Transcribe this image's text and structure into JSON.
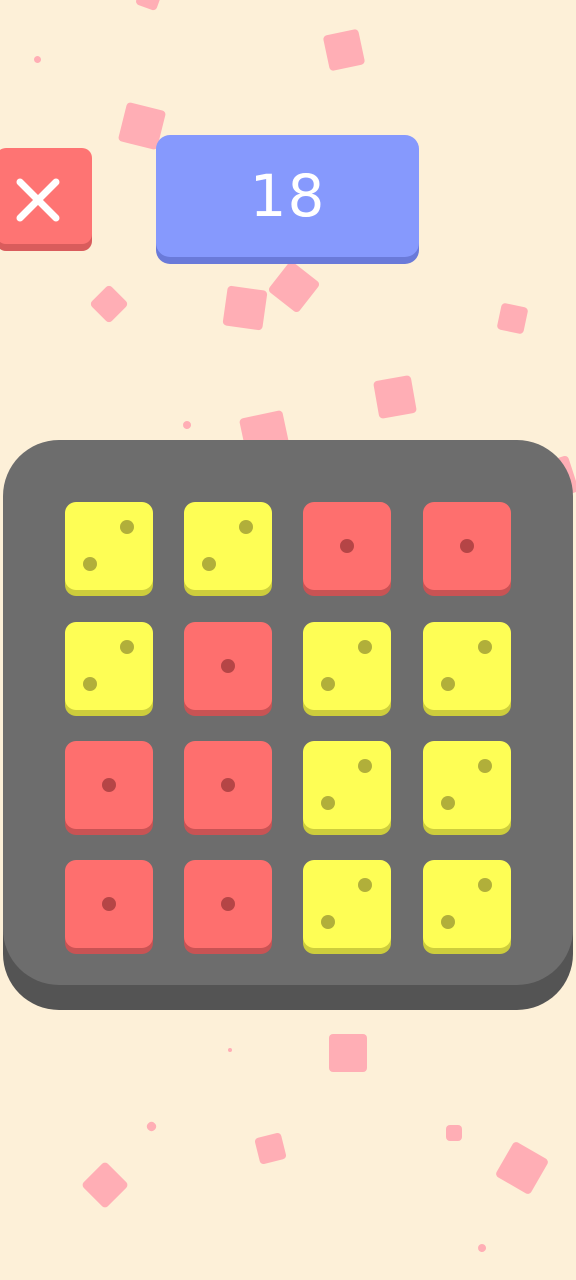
{
  "score": {
    "value": "18"
  },
  "close_button": {
    "icon": "close-icon"
  },
  "colors": {
    "background": "#fdf0d8",
    "confetti": "#ffaeb5",
    "close_button": "#fe7473",
    "score_box": "#8699fd",
    "board": "#6d6d6d",
    "tile_yellow": "#fefe55",
    "tile_red": "#fe6f6e"
  },
  "board": {
    "rows": [
      [
        {
          "color": "yellow",
          "pips": 2
        },
        {
          "color": "yellow",
          "pips": 2
        },
        {
          "color": "red",
          "pips": 1
        },
        {
          "color": "red",
          "pips": 1
        }
      ],
      [
        {
          "color": "yellow",
          "pips": 2
        },
        {
          "color": "red",
          "pips": 1
        },
        {
          "color": "yellow",
          "pips": 2
        },
        {
          "color": "yellow",
          "pips": 2
        }
      ],
      [
        {
          "color": "red",
          "pips": 1
        },
        {
          "color": "red",
          "pips": 1
        },
        {
          "color": "yellow",
          "pips": 2
        },
        {
          "color": "yellow",
          "pips": 2
        }
      ],
      [
        {
          "color": "red",
          "pips": 1
        },
        {
          "color": "red",
          "pips": 1
        },
        {
          "color": "yellow",
          "pips": 2
        },
        {
          "color": "yellow",
          "pips": 2
        }
      ]
    ]
  }
}
